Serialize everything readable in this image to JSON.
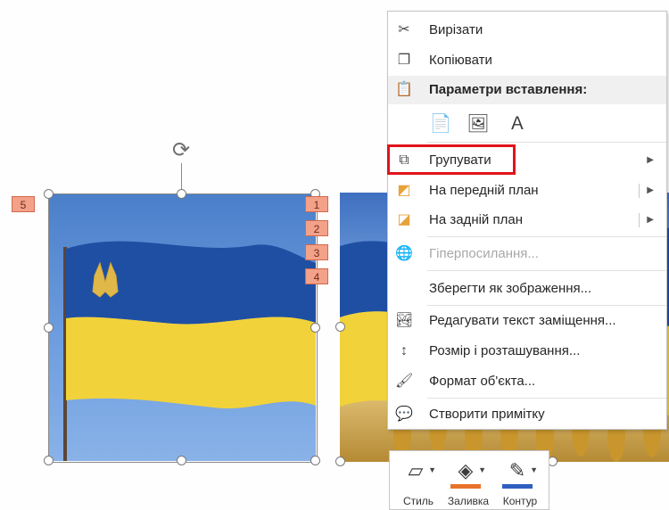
{
  "slide": {
    "tags": [
      "5",
      "1",
      "2",
      "3",
      "4"
    ]
  },
  "context_menu": {
    "cut": "Вирізати",
    "copy": "Копіювати",
    "paste_options_header": "Параметри вставлення:",
    "group": "Групувати",
    "bring_to_front": "На передній план",
    "send_to_back": "На задній план",
    "hyperlink": "Гіперпосилання...",
    "save_as_picture": "Зберегти як зображення...",
    "edit_alt_text": "Редагувати текст заміщення...",
    "size_and_position": "Розмір і розташування...",
    "format_object": "Формат об'єкта...",
    "new_comment": "Створити примітку"
  },
  "mini_toolbar": {
    "style": "Стиль",
    "fill": "Заливка",
    "outline": "Контур",
    "fill_color": "#e8722c",
    "outline_color": "#2f5fbf"
  },
  "colors": {
    "highlight": "#e2131b",
    "flag_blue": "#1f4fa3",
    "flag_yellow": "#f2d23a"
  }
}
